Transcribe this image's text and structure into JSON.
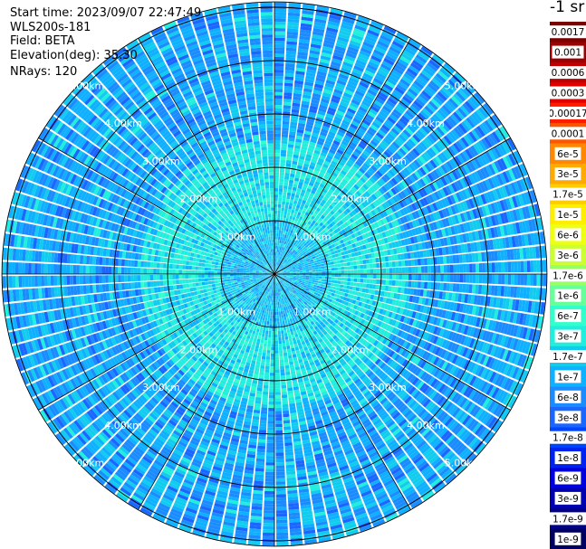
{
  "header": {
    "start_time": "Start time: 2023/09/07 22:47:49",
    "device": "WLS200s-181",
    "field": "Field: BETA",
    "elevation": "Elevation(deg): 35.30",
    "nrays": "NRays: 120"
  },
  "colorbar": {
    "title": "-1 sr",
    "labels": [
      "0.0017",
      "0.001",
      "0.0006",
      "0.0003",
      "0.00017",
      "0.0001",
      "6e-5",
      "3e-5",
      "1.7e-5",
      "1e-5",
      "6e-6",
      "3e-6",
      "1.7e-6",
      "1e-6",
      "6e-7",
      "3e-7",
      "1.7e-7",
      "1e-7",
      "6e-8",
      "3e-8",
      "1.7e-8",
      "1e-8",
      "6e-9",
      "3e-9",
      "1.7e-9",
      "1e-9"
    ],
    "colors": [
      "#7a0000",
      "#9c0000",
      "#c00000",
      "#e00000",
      "#ff1a00",
      "#ff5500",
      "#ff8800",
      "#ffaa00",
      "#ffcc00",
      "#ffee00",
      "#eeff11",
      "#ccff33",
      "#99ff66",
      "#66ff99",
      "#33ffcc",
      "#22eedd",
      "#11ccee",
      "#0fb0ff",
      "#1a8cff",
      "#1a66ff",
      "#0044ff",
      "#0022ee",
      "#0000dd",
      "#0000b0",
      "#000088",
      "#000060"
    ]
  },
  "chart_data": {
    "type": "heatmap",
    "projection": "polar (PPI scan)",
    "n_rays": 120,
    "range_ring_labels": [
      "1.00km",
      "2.00km",
      "3.00km",
      "4.00km",
      "5.00km"
    ],
    "range_rings_km": [
      1,
      2,
      3,
      4,
      5
    ],
    "max_range_km": 5.1,
    "value_ranges_by_range": [
      {
        "range_km": [
          0,
          1
        ],
        "beta_approx": [
          1e-07,
          6e-07
        ]
      },
      {
        "range_km": [
          1,
          2.5
        ],
        "beta_approx": [
          1.7e-07,
          3e-07
        ]
      },
      {
        "range_km": [
          2.5,
          5.1
        ],
        "beta_approx": [
          6e-08,
          1.7e-07
        ]
      }
    ]
  }
}
